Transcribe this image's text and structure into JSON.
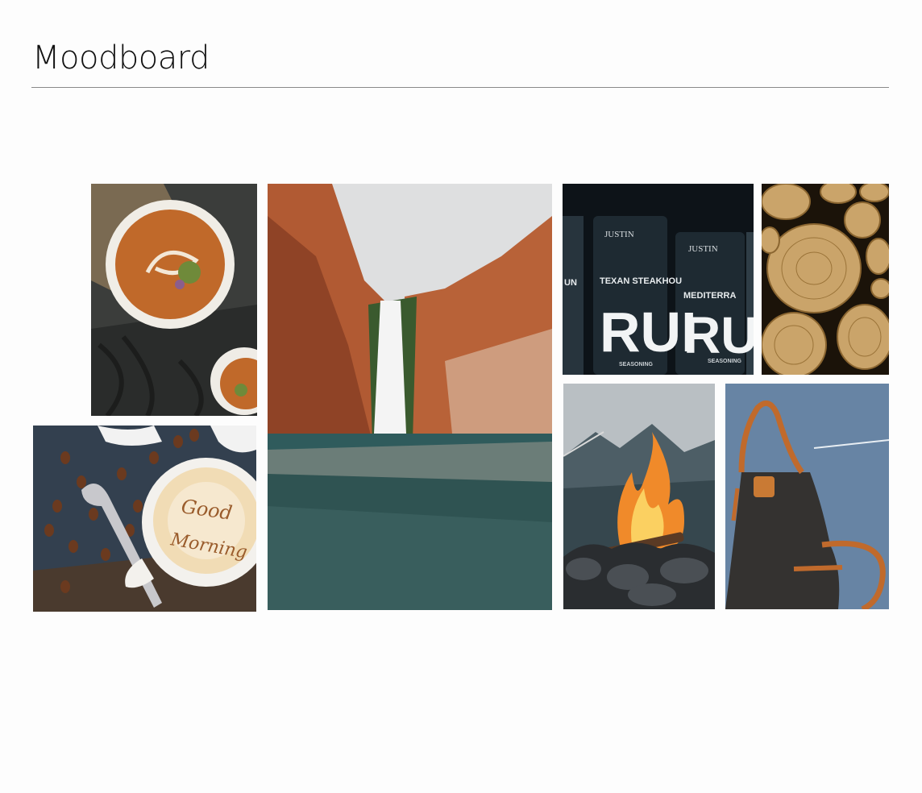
{
  "page": {
    "title": "Moodboard"
  },
  "tiles": [
    {
      "name": "soup-bowl-photo",
      "subject": "bowl of creamy soup on linen"
    },
    {
      "name": "coffee-good-morning-photo",
      "subject": "latte art coffee with beans",
      "latte_text": [
        "Good",
        "Morning"
      ]
    },
    {
      "name": "waterfall-canyon-photo",
      "subject": "waterfall in red rock canyon"
    },
    {
      "name": "seasoning-tins-photo",
      "subject": "seasoning rub tins",
      "tin_labels": [
        "TEXAN STEAKHOU",
        "MEDITERRA",
        "RUI",
        "RUI",
        "SEASONING",
        "SEASONING",
        "JUSTIN",
        "JUSTIN",
        "UN"
      ]
    },
    {
      "name": "firewood-logs-photo",
      "subject": "stacked firewood log ends"
    },
    {
      "name": "campfire-photo",
      "subject": "campfire with mountains"
    },
    {
      "name": "leather-apron-photo",
      "subject": "leather apron on wall"
    }
  ]
}
